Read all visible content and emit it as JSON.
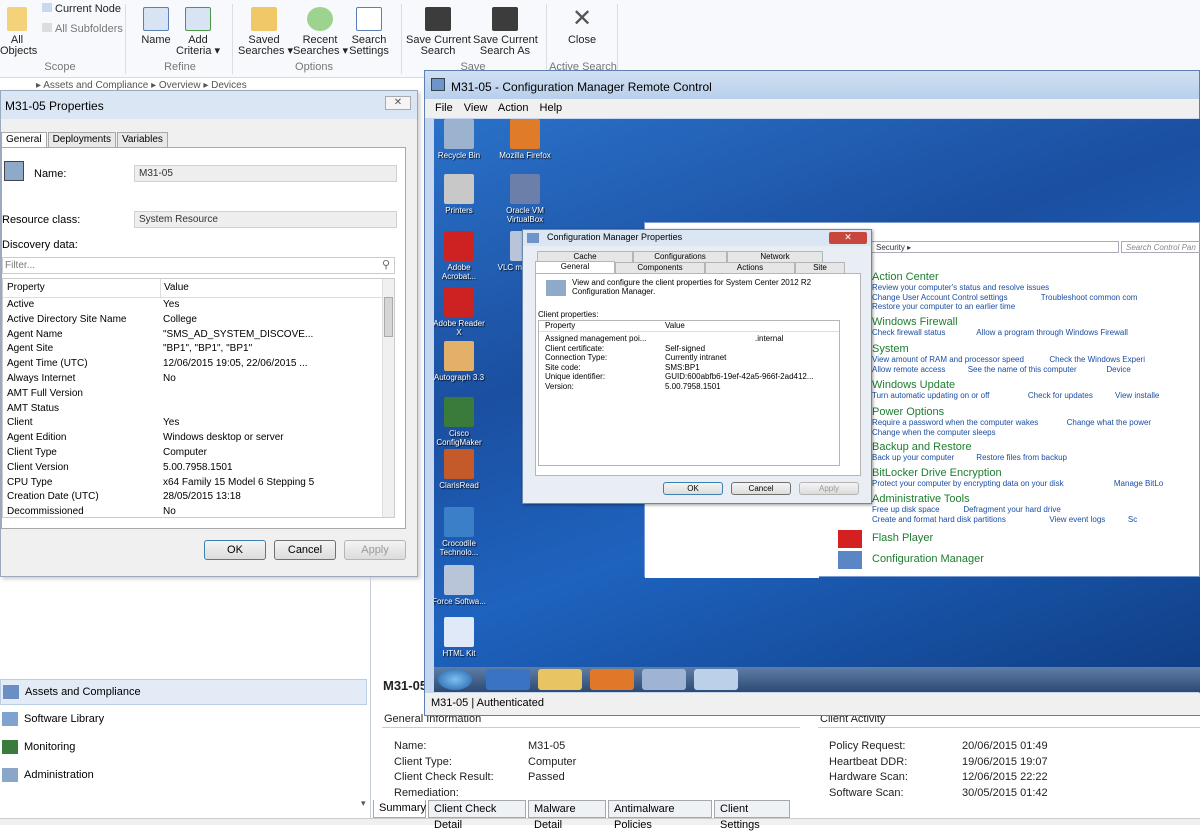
{
  "ribbon": {
    "items": [
      {
        "label": "All\nObjects"
      },
      {
        "label": "Current Node"
      },
      {
        "label": "All Subfolders"
      },
      {
        "label": "Name"
      },
      {
        "label": "Add\nCriteria ▾"
      },
      {
        "label": "Saved\nSearches ▾"
      },
      {
        "label": "Recent\nSearches ▾"
      },
      {
        "label": "Search\nSettings"
      },
      {
        "label": "Save Current\nSearch"
      },
      {
        "label": "Save Current\nSearch As"
      },
      {
        "label": "Close"
      }
    ],
    "groups": [
      "Scope",
      "Refine",
      "Options",
      "Save",
      "Active Search"
    ]
  },
  "breadcrumb": "▸  Assets and Compliance  ▸  Overview  ▸  Devices",
  "props": {
    "title": "M31-05 Properties",
    "tabs": [
      "General",
      "Deployments",
      "Variables"
    ],
    "name_label": "Name:",
    "name_value": "M31-05",
    "class_label": "Resource class:",
    "class_value": "System Resource",
    "discovery_label": "Discovery data:",
    "filter_placeholder": "Filter...",
    "col_property": "Property",
    "col_value": "Value",
    "rows": [
      [
        "Active",
        "Yes"
      ],
      [
        "Active Directory Site Name",
        "College"
      ],
      [
        "Agent Name",
        "\"SMS_AD_SYSTEM_DISCOVE..."
      ],
      [
        "Agent Site",
        "\"BP1\", \"BP1\", \"BP1\""
      ],
      [
        "Agent Time (UTC)",
        "12/06/2015 19:05, 22/06/2015 ..."
      ],
      [
        "Always Internet",
        "No"
      ],
      [
        "AMT Full Version",
        ""
      ],
      [
        "AMT Status",
        ""
      ],
      [
        "Client",
        "Yes"
      ],
      [
        "Agent Edition",
        "Windows desktop or server"
      ],
      [
        "Client Type",
        "Computer"
      ],
      [
        "Client Version",
        "5.00.7958.1501"
      ],
      [
        "CPU Type",
        "x64 Family 15 Model 6 Stepping 5"
      ],
      [
        "Creation Date (UTC)",
        "28/05/2015 13:18"
      ],
      [
        "Decommissioned",
        "No"
      ]
    ],
    "ok": "OK",
    "cancel": "Cancel",
    "apply": "Apply"
  },
  "nav": [
    "Assets and Compliance",
    "Software Library",
    "Monitoring",
    "Administration"
  ],
  "details": {
    "title": "M31-05",
    "section_left": "General Information",
    "section_right": "Client Activity",
    "left": [
      [
        "Name:",
        "M31-05"
      ],
      [
        "Client Type:",
        "Computer"
      ],
      [
        "Client Check Result:",
        "Passed"
      ],
      [
        "Remediation:",
        ""
      ]
    ],
    "right": [
      [
        "Policy Request:",
        "20/06/2015 01:49"
      ],
      [
        "Heartbeat DDR:",
        "19/06/2015 19:07"
      ],
      [
        "Hardware Scan:",
        "12/06/2015 22:22"
      ],
      [
        "Software Scan:",
        "30/05/2015 01:42"
      ]
    ],
    "tabs": [
      "Summary",
      "Client Check Detail",
      "Malware Detail",
      "Antimalware Policies",
      "Client Settings"
    ]
  },
  "remote": {
    "title": "M31-05 - Configuration Manager Remote Control",
    "menu": [
      "File",
      "View",
      "Action",
      "Help"
    ],
    "status": "M31-05 | Authenticated",
    "icons": [
      "Recycle Bin",
      "Mozilla Firefox",
      "Printers",
      "Oracle VM VirtualBox",
      "Adobe Acrobat...",
      "VLC media pl...",
      "Adobe Reader X",
      "Autograph 3.3",
      "Cisco ConfigMaker",
      "ClarisRead",
      "Crocodile Technolo...",
      "Force Softwa...",
      "HTML Kit"
    ],
    "cp": {
      "address": "Security ▸",
      "search_placeholder": "Search Control Pan",
      "sections": [
        {
          "h": "Action Center",
          "links": [
            "Review your computer's status and resolve issues",
            "Change User Account Control settings",
            "Troubleshoot common com",
            "Restore your computer to an earlier time"
          ]
        },
        {
          "h": "Windows Firewall",
          "links": [
            "Check firewall status",
            "Allow a program through Windows Firewall"
          ]
        },
        {
          "h": "System",
          "links": [
            "View amount of RAM and processor speed",
            "Check the Windows Experi",
            "Allow remote access",
            "See the name of this computer",
            "Device"
          ]
        },
        {
          "h": "Windows Update",
          "links": [
            "Turn automatic updating on or off",
            "Check for updates",
            "View installe"
          ]
        },
        {
          "h": "Power Options",
          "links": [
            "Require a password when the computer wakes",
            "Change what the power",
            "Change when the computer sleeps"
          ]
        },
        {
          "h": "Backup and Restore",
          "links": [
            "Back up your computer",
            "Restore files from backup"
          ]
        },
        {
          "h": "BitLocker Drive Encryption",
          "links": [
            "Protect your computer by encrypting data on your disk",
            "Manage BitLo"
          ]
        },
        {
          "h": "Administrative Tools",
          "links": [
            "Free up disk space",
            "Defragment your hard drive",
            "Create and format hard disk partitions",
            "View event logs",
            "Sc"
          ]
        }
      ],
      "extra": [
        "Flash Player",
        "Configuration Manager"
      ]
    },
    "cmp": {
      "title": "Configuration Manager Properties",
      "tabs_top": [
        "Cache",
        "Configurations",
        "Network"
      ],
      "tabs_bottom": [
        "General",
        "Components",
        "Actions",
        "Site"
      ],
      "desc": "View and configure the client properties for System Center 2012 R2 Configuration Manager.",
      "client_props": "Client properties:",
      "col_property": "Property",
      "col_value": "Value",
      "rows": [
        [
          "Assigned management poi...",
          ".internal"
        ],
        [
          "Client certificate:",
          "Self-signed"
        ],
        [
          "Connection Type:",
          "Currently intranet"
        ],
        [
          "Site code:",
          "SMS:BP1"
        ],
        [
          "Unique identifier:",
          "GUID:600abfb6-19ef-42a5-966f-2ad412..."
        ],
        [
          "Version:",
          "5.00.7958.1501"
        ]
      ],
      "ok": "OK",
      "cancel": "Cancel",
      "apply": "Apply"
    }
  },
  "colors": {
    "accent": "#3c7fb1",
    "cp_heading": "#1e7d30",
    "cp_link": "#1a4ea2"
  }
}
